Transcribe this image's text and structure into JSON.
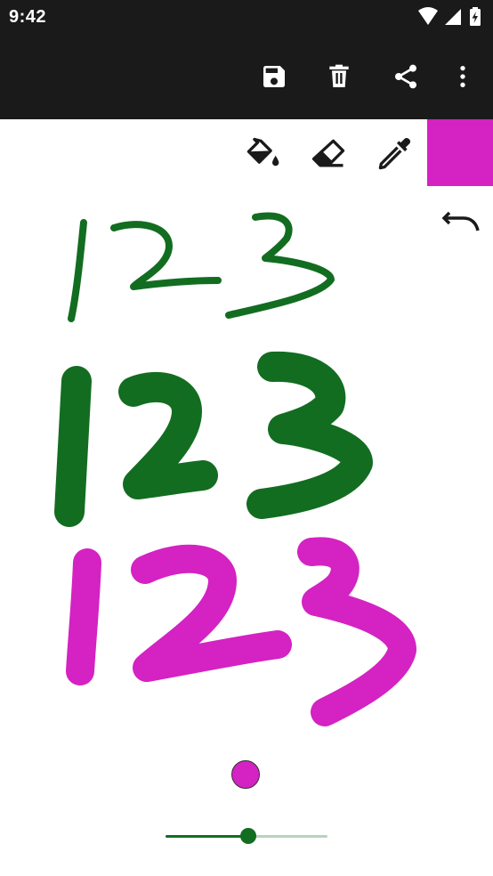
{
  "status_bar": {
    "time": "9:42",
    "icons": [
      "wifi-icon",
      "cell-signal-icon",
      "battery-charging-icon"
    ]
  },
  "toolbar": {
    "actions": [
      "save-icon",
      "delete-icon",
      "share-icon",
      "more-vert-icon"
    ]
  },
  "tools": {
    "items": [
      "paint-bucket-icon",
      "eraser-icon",
      "eyedropper-icon"
    ],
    "selected_color": "#d422c3"
  },
  "canvas": {
    "colors": {
      "green": "#126d21",
      "magenta": "#d422c3"
    }
  },
  "brush": {
    "preview_color": "#d422c3",
    "size_fraction": 0.51
  },
  "colors": {
    "app_bar": "#1a1a1a",
    "accent": "#126d21",
    "track": "#b9d3bd"
  }
}
